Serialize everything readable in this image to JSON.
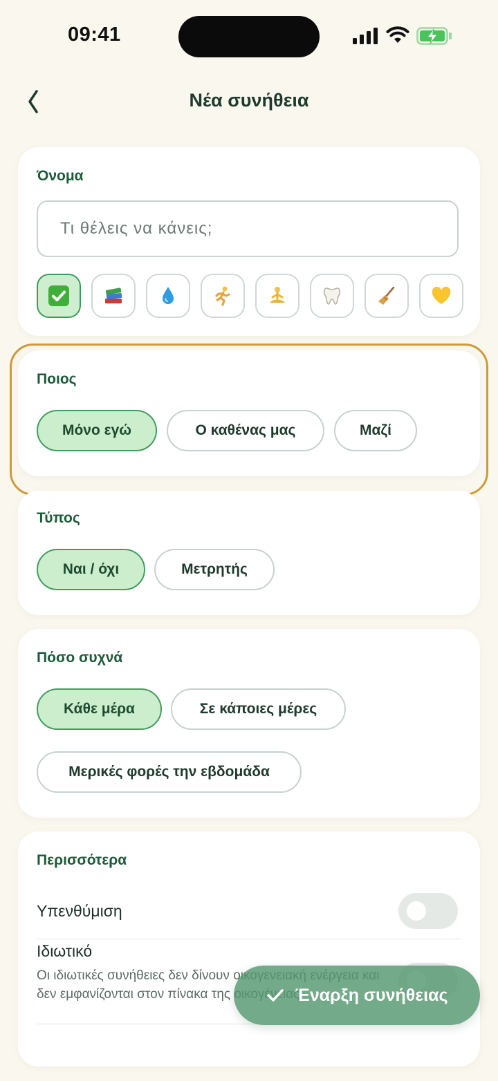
{
  "status_bar": {
    "time": "09:41"
  },
  "header": {
    "title": "Νέα συνήθεια"
  },
  "name_section": {
    "title": "Όνομα",
    "placeholder": "Τι θέλεις να κάνεις;",
    "emojis": [
      "✅",
      "📚",
      "💧",
      "🏃",
      "🧘",
      "🦷",
      "🧹",
      "💛"
    ]
  },
  "who_section": {
    "title": "Ποιος",
    "options": [
      "Μόνο εγώ",
      "Ο καθένας μας",
      "Μαζί"
    ],
    "selected": "Μόνο εγώ"
  },
  "type_section": {
    "title": "Τύπος",
    "options": [
      "Ναι / όχι",
      "Μετρητής"
    ],
    "selected": "Ναι / όχι"
  },
  "frequency_section": {
    "title": "Πόσο συχνά",
    "options": [
      "Κάθε μέρα",
      "Σε κάποιες μέρες",
      "Μερικές φορές την εβδομάδα"
    ],
    "selected": "Κάθε μέρα"
  },
  "more_section": {
    "title": "Περισσότερα",
    "reminder_label": "Υπενθύμιση",
    "private_label": "Ιδιωτικό",
    "private_desc": "Οι ιδιωτικές συνήθειες δεν δίνουν οικογενειακή ενέργεια και δεν εμφανίζονται στον πίνακα της οικογένειας"
  },
  "fab": {
    "label": "Έναρξη συνήθειας"
  },
  "colors": {
    "accent": "#3f9e5e",
    "selected_fill": "#cdeecd",
    "highlight": "#d09a38",
    "background": "#faf7ef"
  }
}
